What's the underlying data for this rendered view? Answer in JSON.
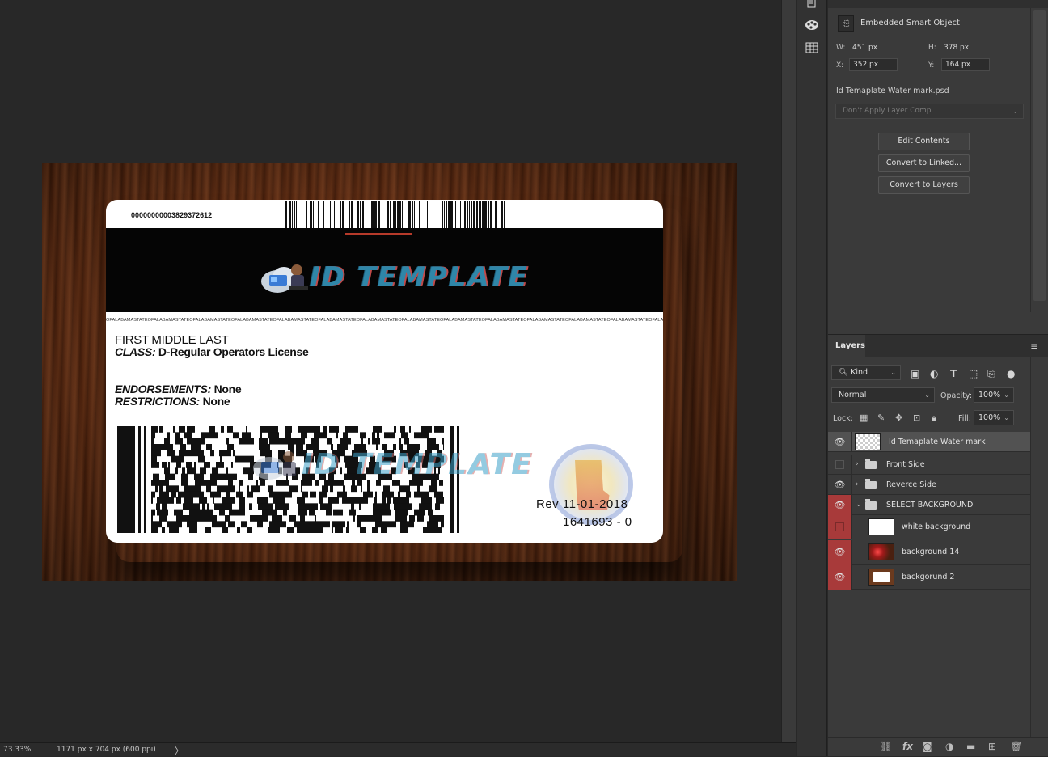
{
  "status": {
    "zoom": "73.33%",
    "doc_info": "1171 px x 704 px (600 ppi)",
    "arrow": "〉"
  },
  "card": {
    "serial": "00000000003829372612",
    "logo_text": "ID TEMPLATE",
    "microtext": "OFALABAMASTATEOFALABAMASTATEOFALABAMASTATEOFALABAMASTATEOFALABAMASTATEOFALABAMASTATEOFALABAMASTATEOFALABAMASTATEOFALABAMASTATEOFALABAMASTATEOFALABAMASTATEOFALABAMASTATEOFALABAMASTATEOFALABAMASTATEOFALABAMASTATE",
    "name": "FIRST MIDDLE LAST",
    "class_label": "CLASS:",
    "class_value": " D-Regular Operators License",
    "endorsements_label": "ENDORSEMENTS:",
    "endorsements_value": " None",
    "restrictions_label": "RESTRICTIONS:",
    "restrictions_value": " None",
    "rev": "Rev  11-01-2018",
    "rev_number": "1641693 - 0"
  },
  "properties": {
    "type_label": "Embedded Smart Object",
    "w_label": "W:",
    "w_value": "451 px",
    "h_label": "H:",
    "h_value": "378 px",
    "x_label": "X:",
    "x_value": "352 px",
    "y_label": "Y:",
    "y_value": "164 px",
    "file_name": "Id Temaplate Water mark.psd",
    "layer_comp": "Don't Apply Layer Comp",
    "buttons": {
      "edit": "Edit Contents",
      "linked": "Convert to Linked...",
      "layers": "Convert to Layers"
    }
  },
  "layers": {
    "tab_label": "Layers",
    "filter_kind": "Kind",
    "blend_mode": "Normal",
    "opacity_label": "Opacity:",
    "opacity_value": "100%",
    "lock_label": "Lock:",
    "fill_label": "Fill:",
    "fill_value": "100%",
    "items": [
      {
        "name": "Id Temaplate Water mark"
      },
      {
        "name": "Front Side"
      },
      {
        "name": "Reverce Side"
      },
      {
        "name": "SELECT BACKGROUND"
      },
      {
        "name": "white background"
      },
      {
        "name": "background 14"
      },
      {
        "name": "backgorund 2"
      }
    ]
  },
  "icons": {
    "eye": "eye-icon",
    "folder": "folder-icon",
    "search": "search-icon"
  },
  "colors": {
    "visibility_red": "#a83a3a",
    "logo_blue": "#2f86a8"
  }
}
